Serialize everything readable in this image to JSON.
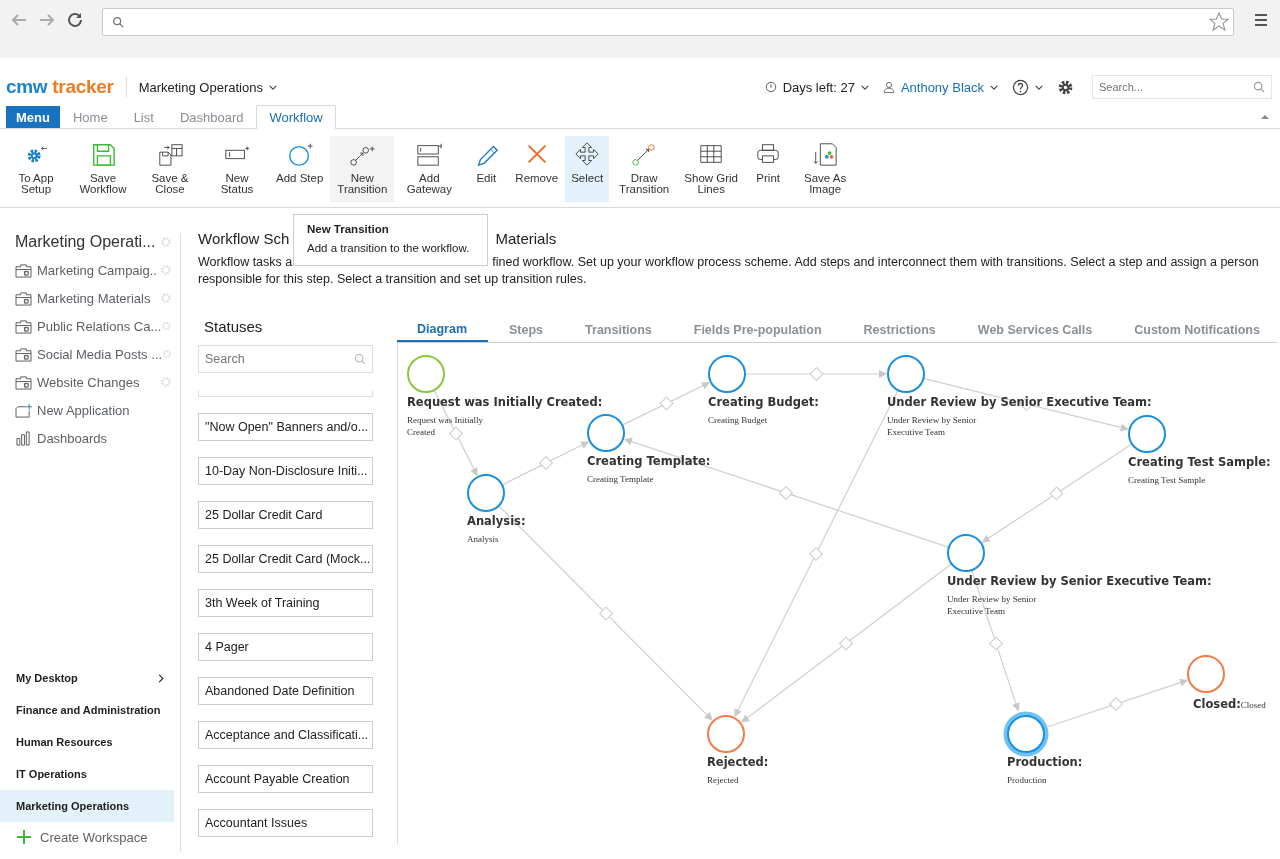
{
  "header": {
    "logo": [
      "cmw",
      "tracker"
    ],
    "workspace": "Marketing Operations",
    "days_left": "Days left: 27",
    "user": "Anthony Black",
    "search": {
      "placeholder": "Search..."
    }
  },
  "nav_tabs": [
    {
      "label": "Menu",
      "kind": "menu",
      "selected": false
    },
    {
      "label": "Home",
      "kind": "tab",
      "selected": false
    },
    {
      "label": "List",
      "kind": "tab",
      "selected": false
    },
    {
      "label": "Dashboard",
      "kind": "tab",
      "selected": false
    },
    {
      "label": "Workflow",
      "kind": "tab",
      "selected": true
    }
  ],
  "ribbon": [
    {
      "label": "To App Setup",
      "selected": false,
      "hovered": false
    },
    {
      "label": "Save Workflow",
      "selected": false,
      "hovered": false
    },
    {
      "label": "Save & Close",
      "selected": false,
      "hovered": false
    },
    {
      "label": "New Status",
      "selected": false,
      "hovered": false
    },
    {
      "label": "Add Step",
      "selected": false,
      "hovered": false
    },
    {
      "label": "New Transition",
      "selected": false,
      "hovered": true
    },
    {
      "label": "Add Gateway",
      "selected": false,
      "hovered": false
    },
    {
      "label": "Edit",
      "selected": false,
      "hovered": false
    },
    {
      "label": "Remove",
      "selected": false,
      "hovered": false
    },
    {
      "label": "Select",
      "selected": true,
      "hovered": false
    },
    {
      "label": "Draw Transition",
      "selected": false,
      "hovered": false
    },
    {
      "label": "Show Grid Lines",
      "selected": false,
      "hovered": false
    },
    {
      "label": "Print",
      "selected": false,
      "hovered": false
    },
    {
      "label": "Save As Image",
      "selected": false,
      "hovered": false
    }
  ],
  "tooltip": {
    "title": "New Transition",
    "text": "Add a transition to the workflow."
  },
  "sidebar": {
    "title": "Marketing Operati...",
    "items": [
      {
        "label": "Marketing Campaig..",
        "kind": "app"
      },
      {
        "label": "Marketing Materials",
        "kind": "app"
      },
      {
        "label": "Public Relations Ca...",
        "kind": "app"
      },
      {
        "label": "Social Media Posts ...",
        "kind": "app"
      },
      {
        "label": "Website Changes",
        "kind": "app"
      },
      {
        "label": "New Application",
        "kind": "new"
      },
      {
        "label": "Dashboards",
        "kind": "dashboards"
      }
    ],
    "workspaces": [
      {
        "label": "My Desktop",
        "expandable": true,
        "selected": false
      },
      {
        "label": "Finance and Administration",
        "expandable": false,
        "selected": false
      },
      {
        "label": "Human Resources",
        "expandable": false,
        "selected": false
      },
      {
        "label": "IT Operations",
        "expandable": false,
        "selected": false
      },
      {
        "label": "Marketing Operations",
        "expandable": false,
        "selected": true
      }
    ],
    "create_workspace": "Create Workspace"
  },
  "heading_parts": [
    "Workflow Sch",
    "Materials"
  ],
  "description": {
    "line1_parts": [
      "Workflow tasks a",
      "fined workflow. Set up your workflow process scheme. Add steps and interconnect them with transitions. Select a step and assign a person"
    ],
    "line2": "responsible for this step. Select a transition and set up transition rules."
  },
  "statuses": {
    "title": "Statuses",
    "search": {
      "placeholder": "Search"
    },
    "items": [
      "\"Now Open\" Banners and/o...",
      "10-Day Non-Disclosure Initi...",
      "25 Dollar Credit Card",
      "25 Dollar Credit Card (Mock...",
      "3th Week of Training",
      "4 Pager",
      "Abandoned Date Definition",
      "Acceptance and Classificati...",
      "Account Payable Creation",
      "Accountant Issues"
    ]
  },
  "diagram_tabs": [
    {
      "label": "Diagram",
      "selected": true
    },
    {
      "label": "Steps",
      "selected": false
    },
    {
      "label": "Transitions",
      "selected": false
    },
    {
      "label": "Fields Pre-population",
      "selected": false
    },
    {
      "label": "Restrictions",
      "selected": false
    },
    {
      "label": "Web Services Calls",
      "selected": false
    },
    {
      "label": "Custom Notifications",
      "selected": false
    }
  ],
  "diagram": {
    "steps": [
      {
        "title": "Request was Initially Created:",
        "subtitle": "Request was Initially Created",
        "kind": "start",
        "selected": false
      },
      {
        "title": "Analysis:",
        "subtitle": "Analysis",
        "kind": "step",
        "selected": false
      },
      {
        "title": "Creating Template:",
        "subtitle": "Creating Template",
        "kind": "step",
        "selected": false
      },
      {
        "title": "Creating Budget:",
        "subtitle": "Creating Budget",
        "kind": "step",
        "selected": false
      },
      {
        "title": "Under Review by Senior Executive Team:",
        "subtitle": "Under Review by Senior Executive Team",
        "kind": "step",
        "selected": false
      },
      {
        "title": "Creating Test Sample:",
        "subtitle": "Creating Test Sample",
        "kind": "step",
        "selected": false
      },
      {
        "title": "Under Review by Senior Executive Team:",
        "subtitle": "Under Review by Senior Executive Team",
        "kind": "step",
        "selected": false
      },
      {
        "title": "Rejected:",
        "subtitle": "Rejected",
        "kind": "final",
        "selected": false
      },
      {
        "title": "Production:",
        "subtitle": "Production",
        "kind": "step",
        "selected": true
      },
      {
        "title": "Closed:",
        "subtitle": "Closed",
        "kind": "final",
        "selected": false
      }
    ]
  }
}
